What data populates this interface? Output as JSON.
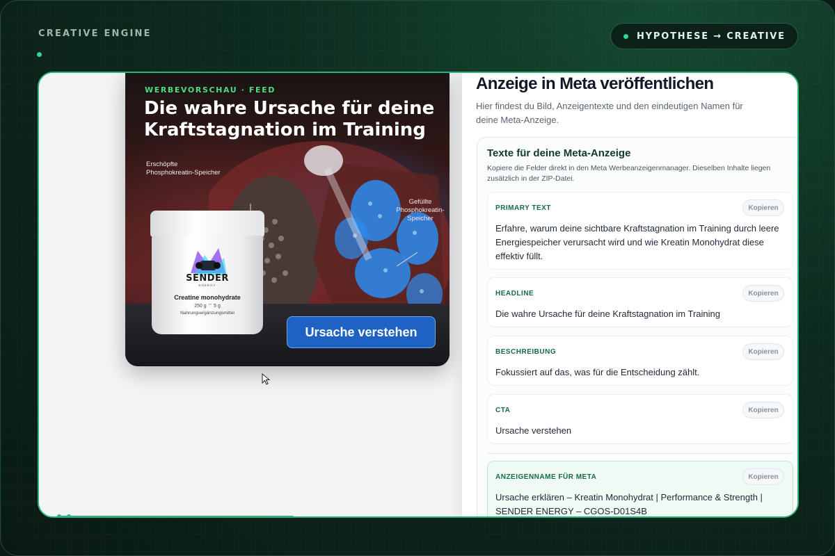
{
  "header": {
    "brand": "CREATIVE ENGINE",
    "pill_label": "HYPOTHESE → CREATIVE"
  },
  "ad_preview": {
    "tag": "WERBEVORSCHAU · FEED",
    "headline": "Die wahre Ursache für deine Kraftstagnation im Training",
    "label_left": "Erschöpfte Phosphokreatin-Speicher",
    "label_right": "Gefüllte Phosphokreatin-Speicher",
    "product": {
      "brand": "SENDER",
      "brand_sub": "ENERGY",
      "name": "Creatine monohydrate",
      "quantity": "250 g  ⌔ 5 g",
      "note": "Nahrungsergänzungsmittel"
    },
    "cta_button": "Ursache verstehen"
  },
  "panel": {
    "title": "Anzeige in Meta veröffentlichen",
    "description": "Hier findest du Bild, Anzeigentexte und den eindeutigen Namen für deine Meta-Anzeige.",
    "texts_card": {
      "title": "Texte für deine Meta-Anzeige",
      "description": "Kopiere die Felder direkt in den Meta Werbeanzeigenmanager. Dieselben Inhalte liegen zusätzlich in der ZIP-Datei.",
      "copy_label": "Kopieren",
      "fields": [
        {
          "label": "PRIMARY TEXT",
          "text": "Erfahre, warum deine sichtbare Kraftstagnation im Training durch leere Energiespeicher verursacht wird und wie Kreatin Monohydrat diese effektiv füllt."
        },
        {
          "label": "HEADLINE",
          "text": "Die wahre Ursache für deine Kraftstagnation im Training"
        },
        {
          "label": "BESCHREIBUNG",
          "text": "Fokussiert auf das, was für die Entscheidung zählt."
        },
        {
          "label": "CTA",
          "text": "Ursache verstehen"
        },
        {
          "label": "ANZEIGENNAME FÜR META",
          "text": "Ursache erklären – Kreatin Monohydrat | Performance & Strength | SENDER ENERGY – CGOS-D01S4B"
        }
      ]
    }
  },
  "colors": {
    "accent": "#2fb37a",
    "cta_blue": "#1e63c4",
    "label_green": "#136b46"
  }
}
